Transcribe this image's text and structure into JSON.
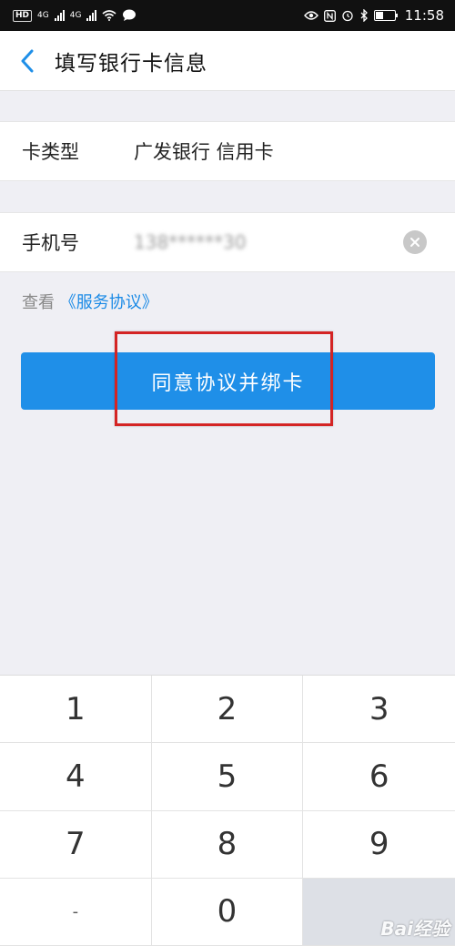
{
  "status_bar": {
    "left_badge": "HD",
    "net1": "4G",
    "net2": "4G",
    "time": "11:58"
  },
  "nav": {
    "title": "填写银行卡信息"
  },
  "card_type": {
    "label": "卡类型",
    "value": "广发银行 信用卡"
  },
  "phone": {
    "label": "手机号",
    "value": "138******30"
  },
  "agreement": {
    "prefix": "查看",
    "link": "《服务协议》"
  },
  "confirm_button": {
    "label": "同意协议并绑卡"
  },
  "keypad": {
    "keys": [
      "1",
      "2",
      "3",
      "4",
      "5",
      "6",
      "7",
      "8",
      "9",
      "-",
      "0",
      ""
    ]
  },
  "watermark": {
    "text": "Bai经验"
  },
  "colors": {
    "accent": "#1f8fe8",
    "highlight": "#d42424",
    "background": "#efeff4"
  }
}
